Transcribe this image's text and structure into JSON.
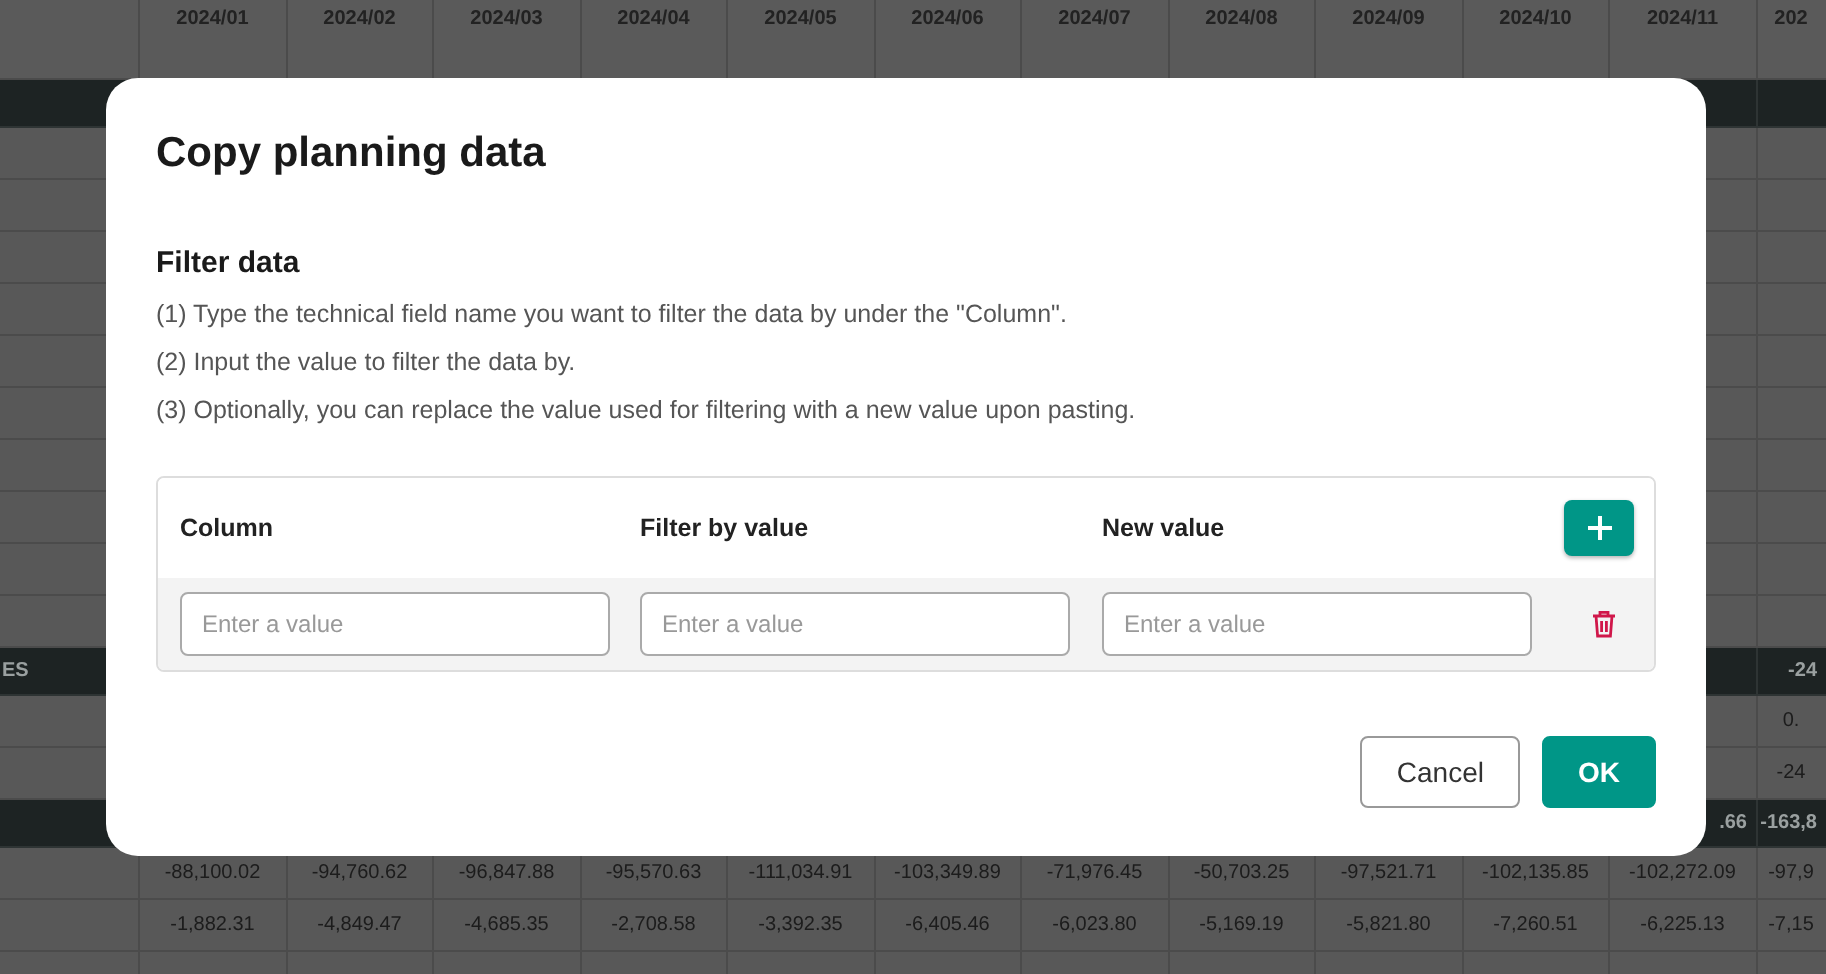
{
  "background_grid": {
    "header": [
      "2024/01",
      "2024/02",
      "2024/03",
      "2024/04",
      "2024/05",
      "2024/06",
      "2024/07",
      "2024/08",
      "2024/09",
      "2024/10",
      "2024/11",
      "202"
    ],
    "rows": [
      {
        "kind": "dark"
      },
      {
        "kind": "band"
      },
      {
        "kind": "band"
      },
      {
        "kind": "band"
      },
      {
        "kind": "band"
      },
      {
        "kind": "band"
      },
      {
        "kind": "band"
      },
      {
        "kind": "band"
      },
      {
        "kind": "band"
      },
      {
        "kind": "band"
      },
      {
        "kind": "band"
      },
      {
        "kind": "dark",
        "label": "ES",
        "values": [
          "-24"
        ]
      },
      {
        "kind": "light",
        "values": [
          "0."
        ]
      },
      {
        "kind": "light",
        "values": [
          "-24"
        ]
      },
      {
        "kind": "dark",
        "values": [
          ".66",
          "-163,8"
        ]
      },
      {
        "kind": "light",
        "values": [
          "-88,100.02",
          "-94,760.62",
          "-96,847.88",
          "-95,570.63",
          "-111,034.91",
          "-103,349.89",
          "-71,976.45",
          "-50,703.25",
          "-97,521.71",
          "-102,135.85",
          "-102,272.09",
          "-97,9"
        ]
      },
      {
        "kind": "light",
        "values": [
          "-1,882.31",
          "-4,849.47",
          "-4,685.35",
          "-2,708.58",
          "-3,392.35",
          "-6,405.46",
          "-6,023.80",
          "-5,169.19",
          "-5,821.80",
          "-7,260.51",
          "-6,225.13",
          "-7,15"
        ]
      },
      {
        "kind": "light"
      }
    ]
  },
  "dialog": {
    "title": "Copy planning data",
    "section_title": "Filter data",
    "instructions": [
      "(1) Type the technical field name you want to filter the data by under the \"Column\".",
      "(2) Input the value to filter the data by.",
      "(3) Optionally, you can replace the value used for filtering with a new value upon pasting."
    ],
    "filter_table": {
      "columns": [
        "Column",
        "Filter by value",
        "New value"
      ],
      "rows": [
        {
          "fields": [
            {
              "placeholder": "Enter a value"
            },
            {
              "placeholder": "Enter a value"
            },
            {
              "placeholder": "Enter a value"
            }
          ]
        }
      ]
    },
    "buttons": [
      {
        "label": "Cancel",
        "kind": "secondary"
      },
      {
        "label": "OK",
        "kind": "primary"
      }
    ]
  }
}
